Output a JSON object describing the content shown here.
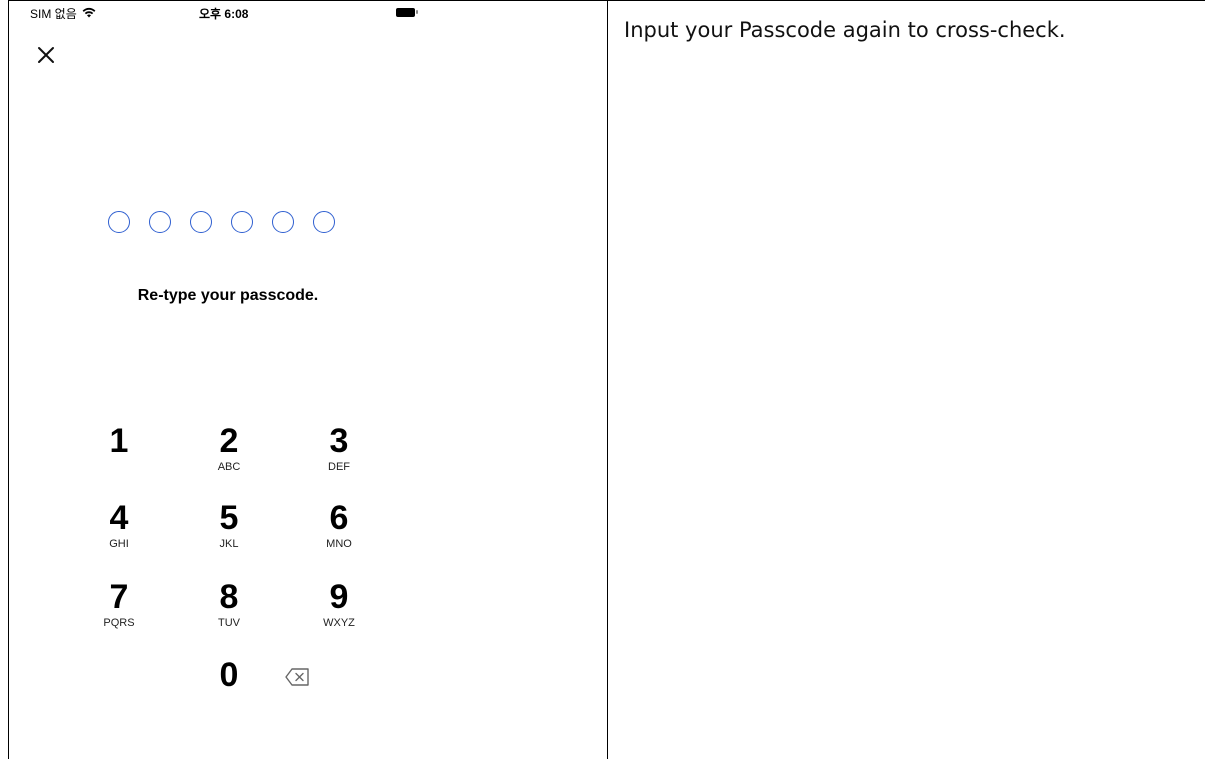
{
  "status_bar": {
    "carrier": "SIM 없음",
    "time": "오후 6:08"
  },
  "icons": {
    "close": "close-icon",
    "wifi": "wifi-icon",
    "battery": "battery-icon",
    "backspace": "backspace-icon"
  },
  "passcode": {
    "dot_count": 6,
    "filled_count": 0,
    "prompt": "Re-type your passcode."
  },
  "keypad": {
    "keys": [
      {
        "digit": "1",
        "letters": ""
      },
      {
        "digit": "2",
        "letters": "ABC"
      },
      {
        "digit": "3",
        "letters": "DEF"
      },
      {
        "digit": "4",
        "letters": "GHI"
      },
      {
        "digit": "5",
        "letters": "JKL"
      },
      {
        "digit": "6",
        "letters": "MNO"
      },
      {
        "digit": "7",
        "letters": "PQRS"
      },
      {
        "digit": "8",
        "letters": "TUV"
      },
      {
        "digit": "9",
        "letters": "WXYZ"
      },
      {
        "digit": "0",
        "letters": ""
      }
    ]
  },
  "instruction": {
    "text": "Input your Passcode again to cross-check."
  },
  "colors": {
    "dot_outline": "#2f5fd0",
    "text": "#000000"
  }
}
